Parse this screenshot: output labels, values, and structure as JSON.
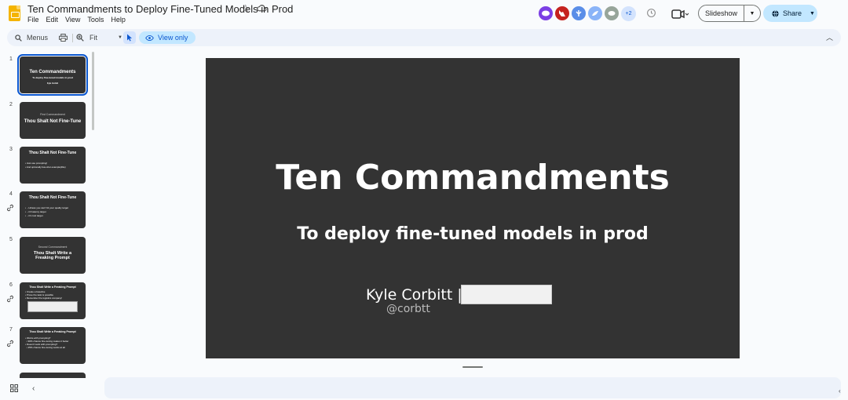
{
  "header": {
    "title": "Ten Commandments to Deploy Fine-Tuned Models in Prod",
    "menus": [
      "File",
      "Edit",
      "View",
      "Tools",
      "Help"
    ],
    "collaborators": [
      {
        "icon": "hippo-icon",
        "color": "#7b3fe4"
      },
      {
        "icon": "fox-icon",
        "color": "#c5221f"
      },
      {
        "icon": "bat-icon",
        "color": "#5a8ee8"
      },
      {
        "icon": "dolphin-icon",
        "color": "#8ab4f8"
      },
      {
        "icon": "capybara-icon",
        "color": "#97a59a"
      }
    ],
    "more_collaborators": "+2",
    "slideshow_label": "Slideshow",
    "share_label": "Share"
  },
  "toolbar": {
    "menus_label": "Menus",
    "zoom_label": "Fit",
    "view_only_label": "View only"
  },
  "filmstrip": [
    {
      "num": "1",
      "lines": [
        "Ten Commandments",
        "To deploy fine-tuned models in prod",
        "Kyle Corbitt"
      ]
    },
    {
      "num": "2",
      "lines": [
        "First Commandment",
        "Thou Shalt Not Fine-Tune"
      ]
    },
    {
      "num": "3",
      "lines": [
        "Thou Shalt Not Fine-Tune",
        "Just use prompting!",
        "And optionally few-shot example(ible)"
      ]
    },
    {
      "num": "4",
      "lines": [
        "Thou Shalt Not Fine-Tune",
        "...Unless you can't hit your quality target",
        "...Or latency target",
        "...Or cost target"
      ]
    },
    {
      "num": "5",
      "lines": [
        "Second Commandment",
        "Thou Shalt Write a",
        "Freaking Prompt"
      ]
    },
    {
      "num": "6",
      "lines": [
        "Thou Shalt Write a Freaking Prompt",
        "Create a baseline",
        "Prove the task is possible",
        "Remember the logistics company!"
      ]
    },
    {
      "num": "7",
      "lines": [
        "Thou Shalt Write a Freaking Prompt",
        "Works with prompting?",
        "90% chance fine-tuning makes it better",
        "Doesn't work with prompting?",
        "25% chance fine-tuning works at all"
      ]
    }
  ],
  "slide": {
    "title": "Ten Commandments",
    "subtitle": "To deploy fine-tuned models in prod",
    "author": "Kyle Corbitt |",
    "handle": "@corbtt"
  }
}
